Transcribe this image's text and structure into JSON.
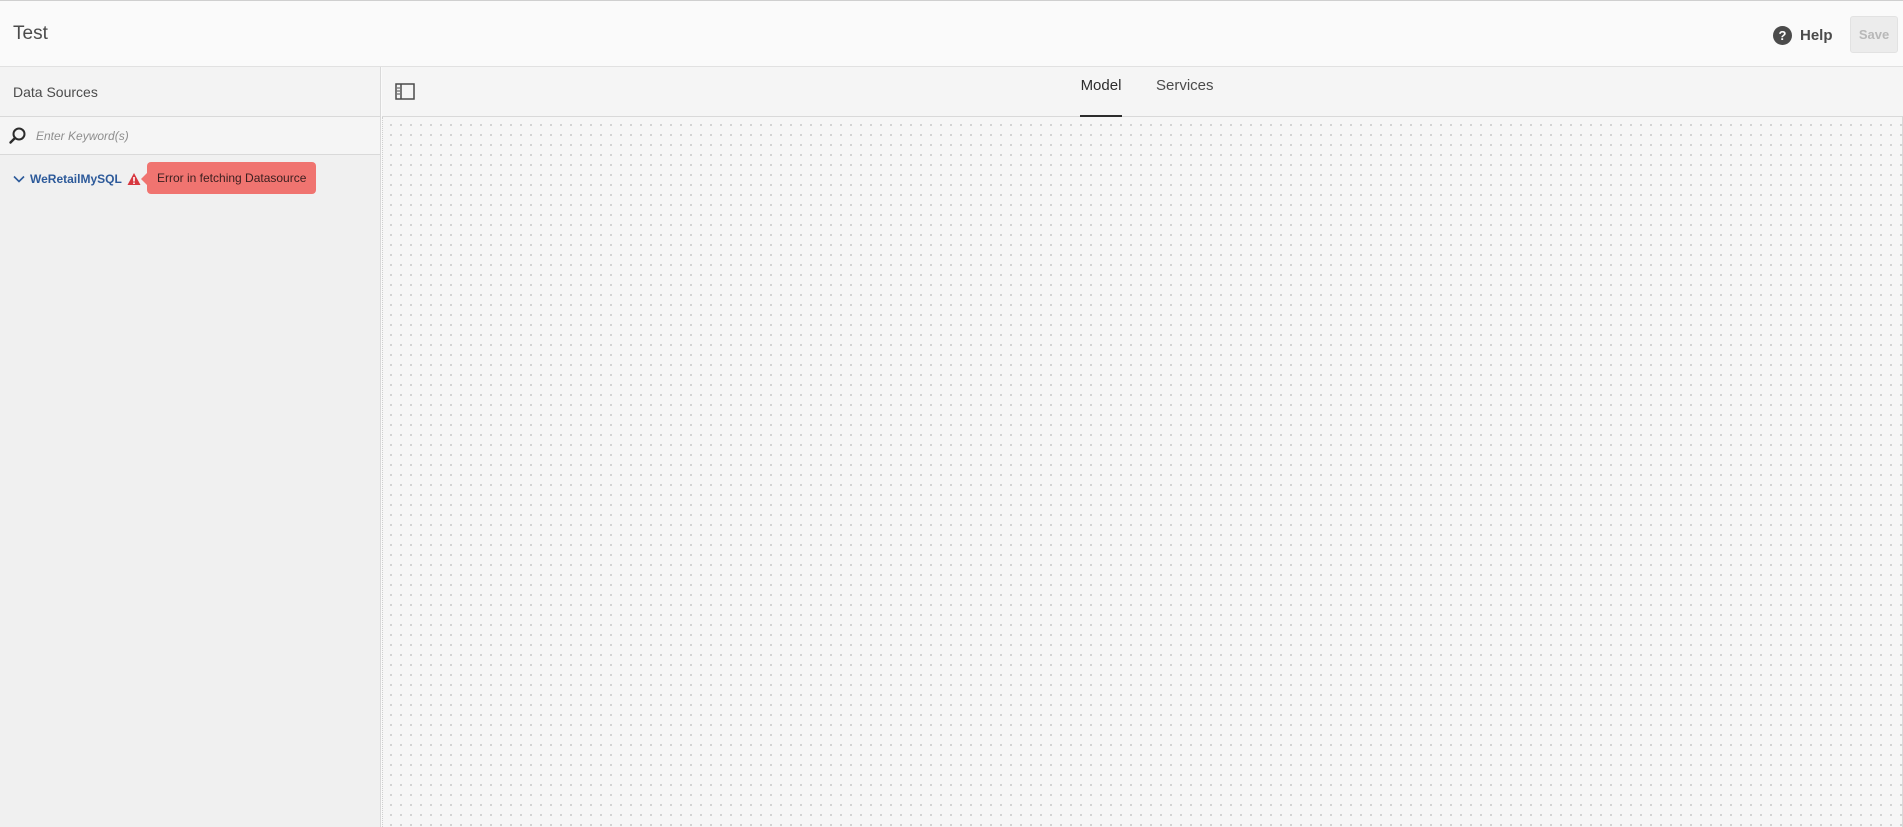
{
  "header": {
    "title": "Test",
    "help_label": "Help",
    "save_label": "Save"
  },
  "sidebar": {
    "title": "Data Sources",
    "search": {
      "placeholder": "Enter Keyword(s)",
      "value": ""
    },
    "datasources": [
      {
        "name": "WeRetailMySQL",
        "expanded": true,
        "status": "error",
        "error_message": "Error in fetching Datasource"
      }
    ]
  },
  "main": {
    "tabs": [
      {
        "label": "Model",
        "active": true
      },
      {
        "label": "Services",
        "active": false
      }
    ]
  },
  "colors": {
    "accent_link": "#2d5a9a",
    "error_tooltip": "#f07470",
    "warning_icon": "#d7373f",
    "save_disabled_text": "#b8b8b8"
  },
  "icons": [
    "help-icon",
    "search-icon",
    "chevron-down-icon",
    "warning-icon",
    "panel-toggle-icon"
  ]
}
